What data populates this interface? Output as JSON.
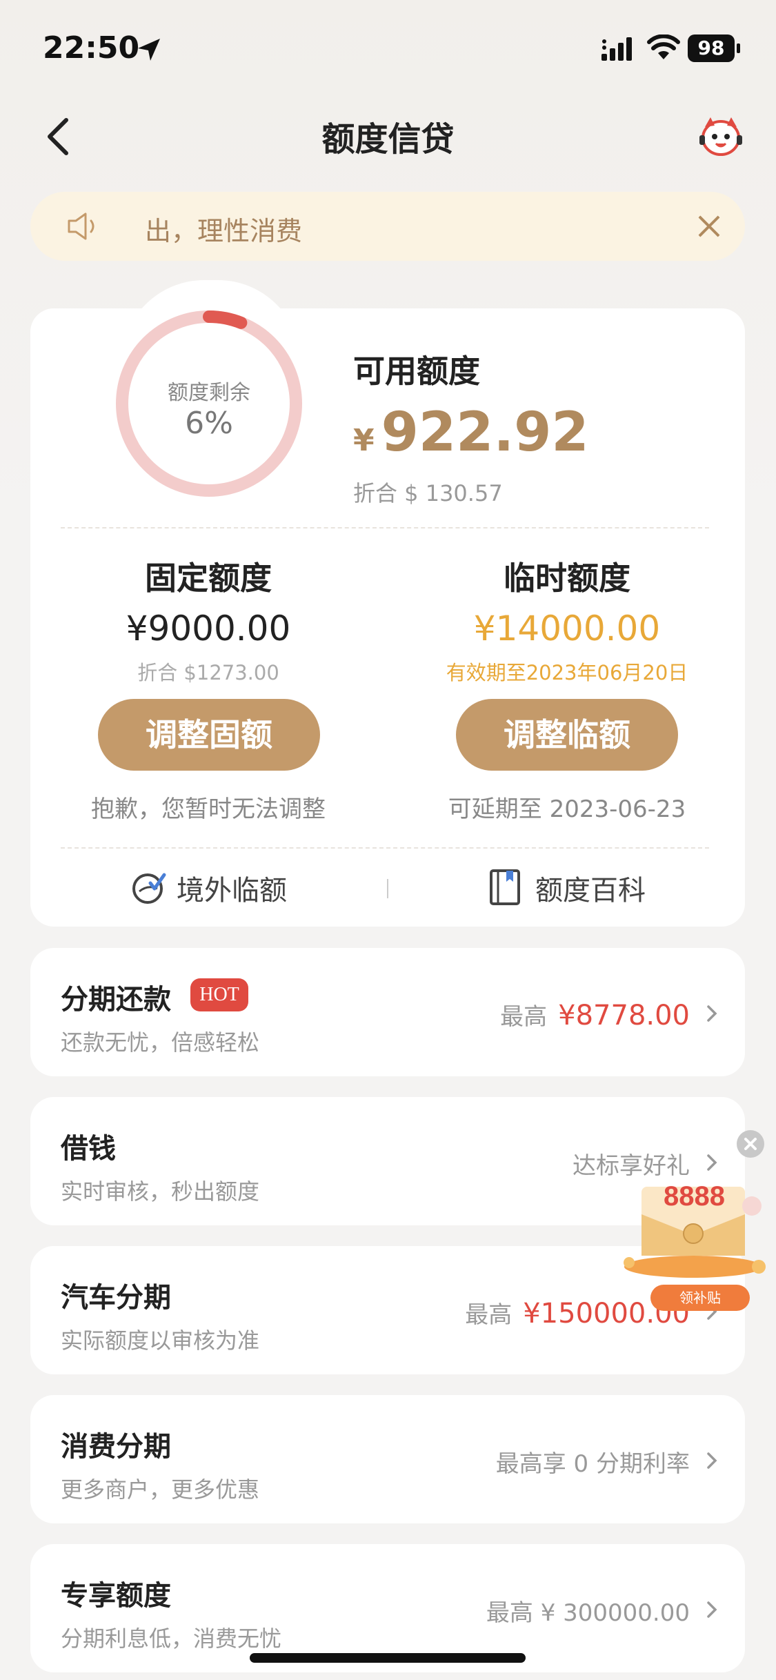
{
  "status_bar": {
    "time": "22:50",
    "battery": "98"
  },
  "nav": {
    "title": "额度信贷"
  },
  "notice": {
    "text": "出，理性消费"
  },
  "credit": {
    "ring_label": "额度剩余",
    "ring_percent": "6%",
    "ring_fraction": 0.06,
    "available_label": "可用额度",
    "available_currency": "¥",
    "available_amount": "922.92",
    "available_usd": "折合 $ 130.57",
    "fixed": {
      "title": "固定额度",
      "amount": "¥9000.00",
      "usd": "折合 $1273.00",
      "button": "调整固额",
      "note": "抱歉，您暂时无法调整"
    },
    "temp": {
      "title": "临时额度",
      "amount": "¥14000.00",
      "validity": "有效期至2023年06月20日",
      "button": "调整临额",
      "note": "可延期至 2023-06-23"
    },
    "links": {
      "overseas": "境外临额",
      "wiki": "额度百科"
    }
  },
  "rows": [
    {
      "title": "分期还款",
      "badge": "HOT",
      "sub": "还款无忧，倍感轻松",
      "prefix": "最高",
      "value": "¥8778.00"
    },
    {
      "title": "借钱",
      "sub": "实时审核，秒出额度",
      "prefix": "达标享好礼",
      "value": ""
    },
    {
      "title": "汽车分期",
      "sub": "实际额度以审核为准",
      "prefix": "最高",
      "value": "¥150000.00"
    },
    {
      "title": "消费分期",
      "sub": "更多商户，更多优惠",
      "prefix": "最高享 0 分期利率",
      "value": ""
    },
    {
      "title": "专享额度",
      "sub": "分期利息低，消费无忧",
      "prefix": "最高 ¥ 300000.00",
      "value": ""
    }
  ],
  "promo": {
    "amount": "8888",
    "button": "领补贴"
  },
  "colors": {
    "accent_gold": "#c49a6a",
    "amount_gold": "#b08a5e",
    "temp_orange": "#e8a838",
    "red": "#e04a40",
    "ring_bg": "#f3cccb",
    "ring_fg": "#e05a52"
  }
}
